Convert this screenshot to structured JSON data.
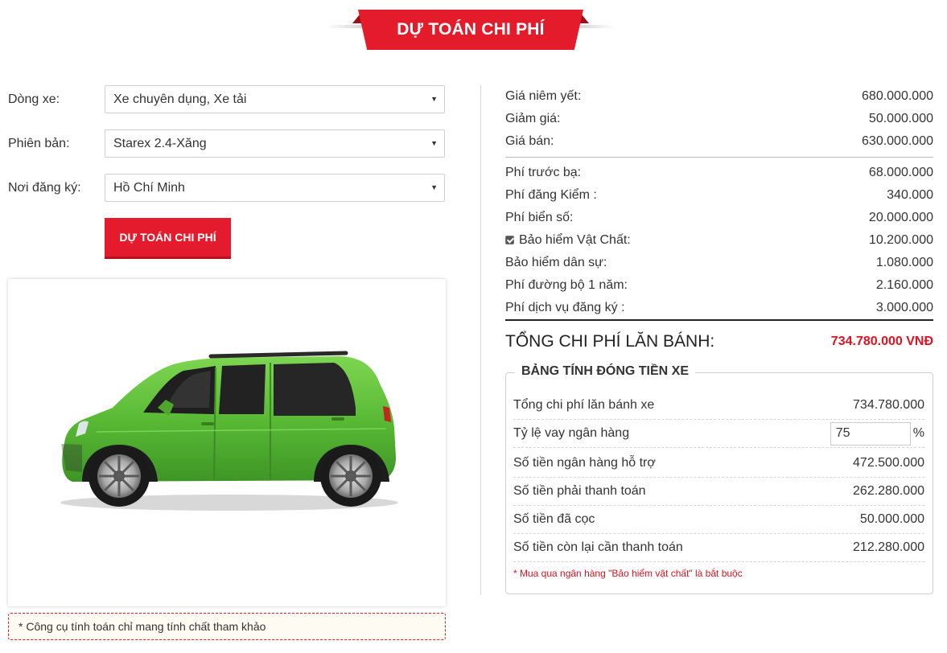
{
  "title": "DỰ TOÁN CHI PHÍ",
  "form": {
    "rows": [
      {
        "label": "Dòng xe:",
        "value": "Xe chuyên dụng, Xe tải"
      },
      {
        "label": "Phiên bản:",
        "value": "Starex 2.4-Xăng"
      },
      {
        "label": "Nơi đăng ký:",
        "value": "Hồ Chí Minh"
      }
    ],
    "button_label": "DỰ TOÁN CHI PHÍ",
    "caret": "▼"
  },
  "note": "* Công cụ tính toán chỉ mang tính chất tham khảo",
  "prices": {
    "group1": [
      {
        "label": "Giá niêm yết:",
        "value": "680.000.000"
      },
      {
        "label": "Giảm giá:",
        "value": "50.000.000"
      },
      {
        "label": "Giá bán:",
        "value": "630.000.000"
      }
    ],
    "group2": [
      {
        "label": "Phí trước bạ:",
        "value": "68.000.000"
      },
      {
        "label": "Phí đăng Kiểm :",
        "value": "340.000"
      },
      {
        "label": "Phí biển số:",
        "value": "20.000.000"
      },
      {
        "label": "Bảo hiểm Vật Chất:",
        "value": "10.200.000"
      },
      {
        "label": "Bảo hiểm dân sự:",
        "value": "1.080.000"
      },
      {
        "label": "Phí đường bộ 1 năm:",
        "value": "2.160.000"
      },
      {
        "label": "Phí dịch vụ đăng ký :",
        "value": "3.000.000"
      }
    ],
    "insurance_checked": true
  },
  "total": {
    "label": "TỔNG CHI PHÍ LĂN BÁNH:",
    "value": "734.780.000 VNĐ"
  },
  "payment": {
    "legend": "BẢNG TÍNH ĐÓNG TIỀN XE",
    "rows": [
      {
        "label": "Tổng chi phí lăn bánh xe",
        "value": "734.780.000"
      },
      {
        "label": "Tỷ lệ vay ngân hàng",
        "value": "75",
        "unit": "%"
      },
      {
        "label": "Số tiền ngân hàng hỗ trợ",
        "value": "472.500.000"
      },
      {
        "label": "Số tiền phải thanh toán",
        "value": "262.280.000"
      },
      {
        "label": "Số tiền đã cọc",
        "value": "50.000.000"
      },
      {
        "label": "Số tiền còn lại cần thanh toán",
        "value": "212.280.000"
      }
    ],
    "note": "* Mua qua ngân hàng \"Bảo hiểm vật chất\" là bắt buộc"
  },
  "colors": {
    "accent": "#e41b2b",
    "car_body": "#5fbf3a"
  }
}
